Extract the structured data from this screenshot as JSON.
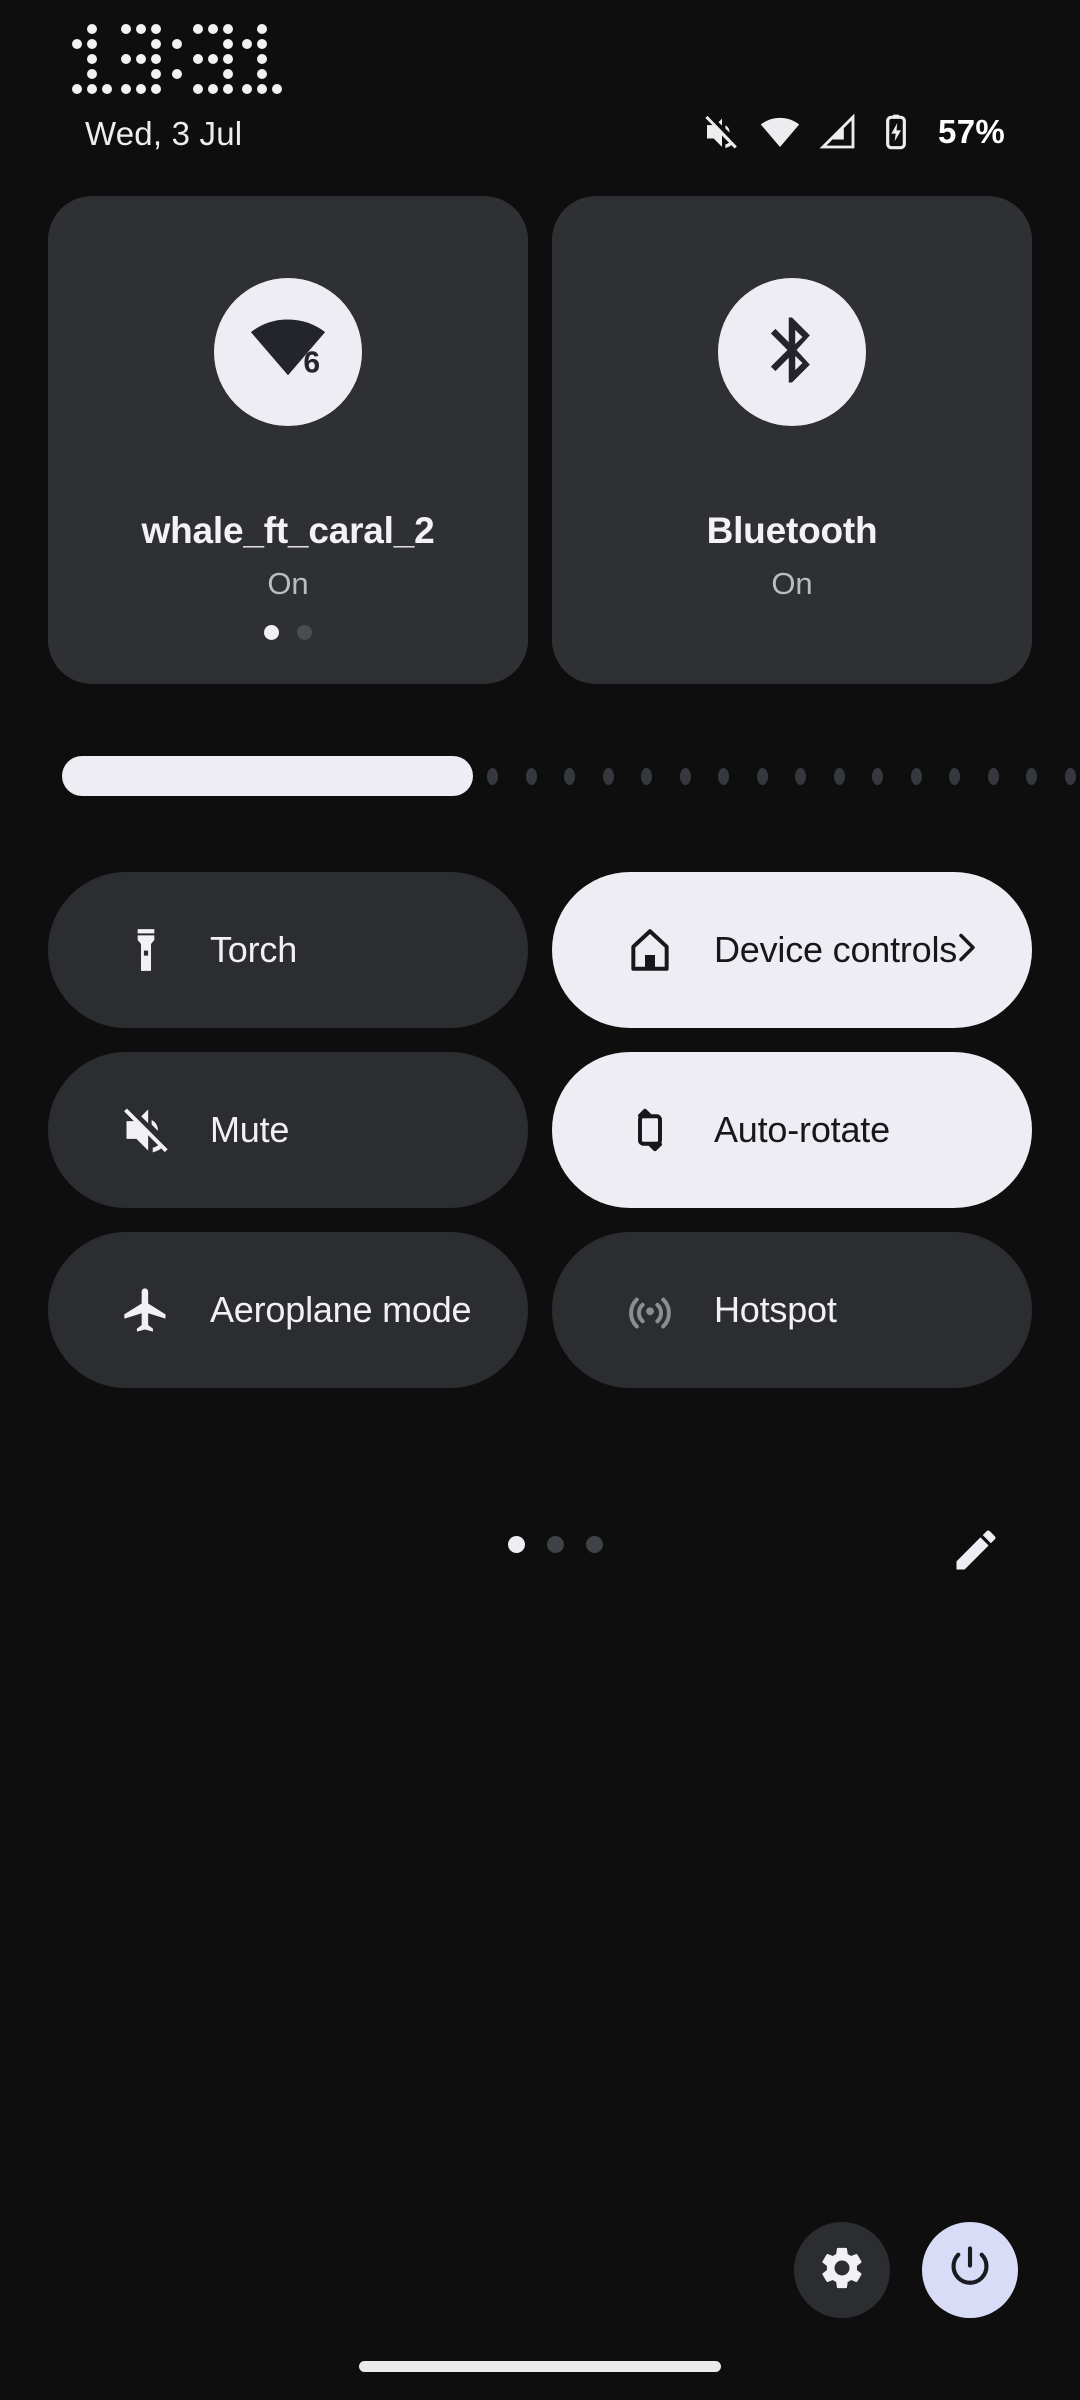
{
  "statusbar": {
    "clock": "13:31",
    "date": "Wed, 3 Jul",
    "battery_percent": "57%",
    "icons": [
      "mute-icon",
      "wifi-icon",
      "cell-signal-icon",
      "battery-charging-icon"
    ]
  },
  "big_tiles": [
    {
      "name": "wifi",
      "icon": "wifi-6-icon",
      "title": "whale_ft_caral_2",
      "subtitle": "On",
      "dots": 2,
      "active_dot": 0
    },
    {
      "name": "bluetooth",
      "icon": "bluetooth-icon",
      "title": "Bluetooth",
      "subtitle": "On",
      "dots": 0,
      "active_dot": -1
    }
  ],
  "brightness": {
    "label": "brightness-slider",
    "value_percent": 42
  },
  "quick_tiles": [
    {
      "label": "Torch",
      "icon": "flashlight-icon",
      "active": false,
      "dimmed_icon": false,
      "chevron": false
    },
    {
      "label": "Device controls",
      "icon": "home-icon",
      "active": true,
      "dimmed_icon": false,
      "chevron": true
    },
    {
      "label": "Mute",
      "icon": "volume-off-icon",
      "active": false,
      "dimmed_icon": false,
      "chevron": false
    },
    {
      "label": "Auto-rotate",
      "icon": "auto-rotate-icon",
      "active": true,
      "dimmed_icon": false,
      "chevron": false
    },
    {
      "label": "Aeroplane mode",
      "icon": "airplane-icon",
      "active": false,
      "dimmed_icon": false,
      "chevron": false
    },
    {
      "label": "Hotspot",
      "icon": "hotspot-icon",
      "active": false,
      "dimmed_icon": true,
      "chevron": false
    }
  ],
  "pager": {
    "count": 3,
    "active": 0
  },
  "edit_button": {
    "icon": "pencil-icon"
  },
  "bottom": {
    "settings": {
      "icon": "gear-icon"
    },
    "power": {
      "icon": "power-icon"
    }
  },
  "colors": {
    "background": "#0E0E0E",
    "tile_inactive": "#2B2D30",
    "tile_active": "#EFEDF4",
    "big_tile": "#2E3033",
    "power_button": "#D8DCF6",
    "text_primary": "#F1F1F4",
    "text_secondary": "#B9BCC0",
    "icon_dimmed": "#8A8E93"
  }
}
